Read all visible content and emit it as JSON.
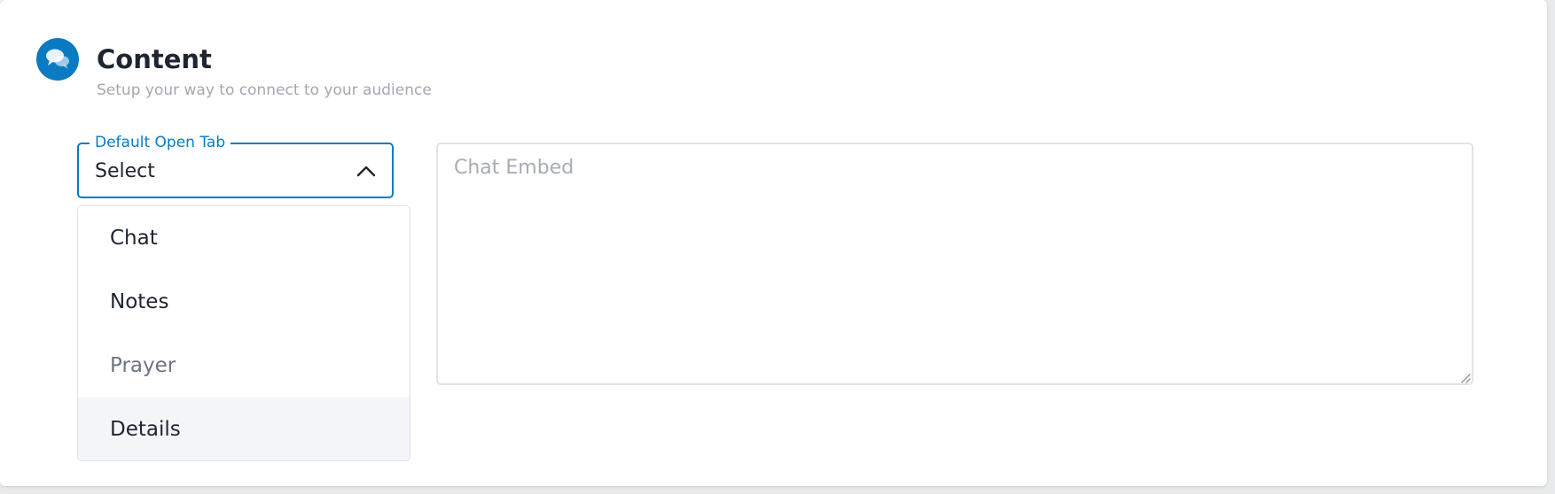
{
  "header": {
    "icon": "chat-bubbles-icon",
    "title": "Content",
    "subtitle": "Setup your way to connect to your audience"
  },
  "default_open_tab": {
    "label": "Default Open Tab",
    "value": "Select",
    "expanded": true,
    "options": [
      {
        "label": "Chat"
      },
      {
        "label": "Notes"
      },
      {
        "label": "Prayer"
      },
      {
        "label": "Details"
      }
    ]
  },
  "chat_embed": {
    "placeholder": "Chat Embed",
    "value": ""
  },
  "colors": {
    "accent": "#0a7ac2",
    "text": "#1f2430",
    "muted": "#a4a8b0"
  }
}
